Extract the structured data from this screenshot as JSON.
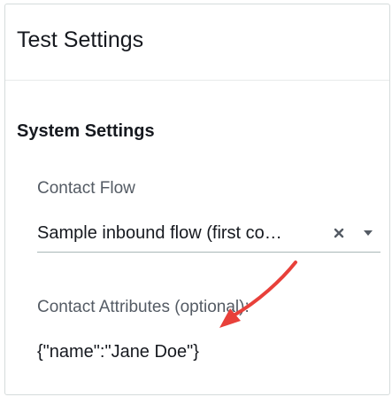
{
  "panel": {
    "title": "Test Settings"
  },
  "system_settings": {
    "heading": "System Settings",
    "contact_flow": {
      "label": "Contact Flow",
      "selected_value": "Sample inbound flow (first co…"
    },
    "contact_attributes": {
      "label": "Contact Attributes (optional):",
      "value": "{\"name\":\"Jane Doe\"}"
    }
  },
  "icons": {
    "clear": "close-icon",
    "dropdown": "chevron-down-icon",
    "annotation": "red-arrow-icon"
  },
  "colors": {
    "annotation_arrow": "#e8403a",
    "text_primary": "#16191f",
    "text_secondary": "#545b64"
  }
}
